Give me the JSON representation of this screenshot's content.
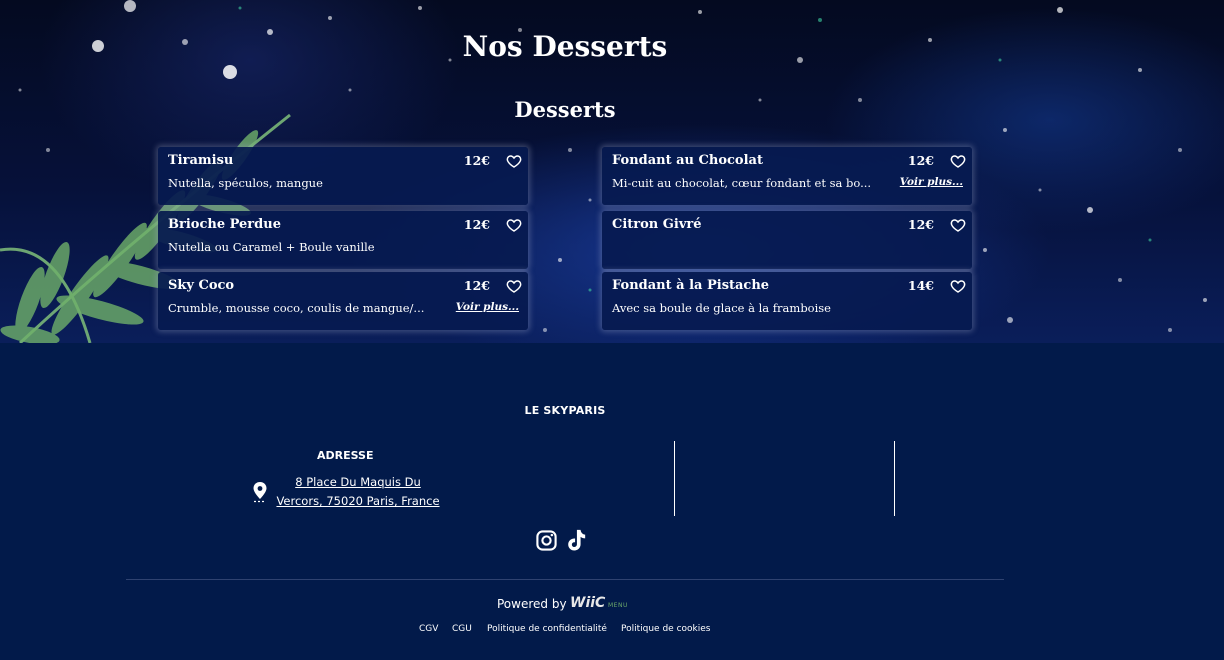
{
  "page_title": "Nos Desserts",
  "section_title": "Desserts",
  "items_left": [
    {
      "name": "Tiramisu",
      "price": "12€",
      "description": "Nutella, spéculos, mangue",
      "more": ""
    },
    {
      "name": "Brioche Perdue",
      "price": "12€",
      "description": "Nutella ou Caramel + Boule vanille",
      "more": ""
    },
    {
      "name": "Sky Coco",
      "price": "12€",
      "description": "Crumble, mousse coco, coulis de mangue/...",
      "more": "Voir plus..."
    }
  ],
  "items_right": [
    {
      "name": "Fondant au Chocolat",
      "price": "12€",
      "description": "Mi-cuit au chocolat, cœur fondant et sa bo...",
      "more": "Voir plus..."
    },
    {
      "name": "Citron Givré",
      "price": "12€",
      "description": "",
      "more": ""
    },
    {
      "name": "Fondant à la Pistache",
      "price": "14€",
      "description": "Avec sa boule de glace à la framboise",
      "more": ""
    }
  ],
  "footer": {
    "brand": "LE SKYPARIS",
    "address_heading": "ADRESSE",
    "address_line1": "8 Place Du Maquis Du",
    "address_line2": "Vercors, 75020 Paris, France",
    "social": [
      "instagram-icon",
      "tiktok-icon"
    ],
    "powered_by": "Powered by",
    "logo_text": "WiiC",
    "logo_sub": "MENU",
    "legal_links": [
      "CGV",
      "CGU",
      "Politique de confidentialité",
      "Politique de cookies"
    ]
  },
  "colors": {
    "footer_bg": "#021a4a",
    "card_bg": "#061a50",
    "logo_accent": "#6ca86a"
  }
}
